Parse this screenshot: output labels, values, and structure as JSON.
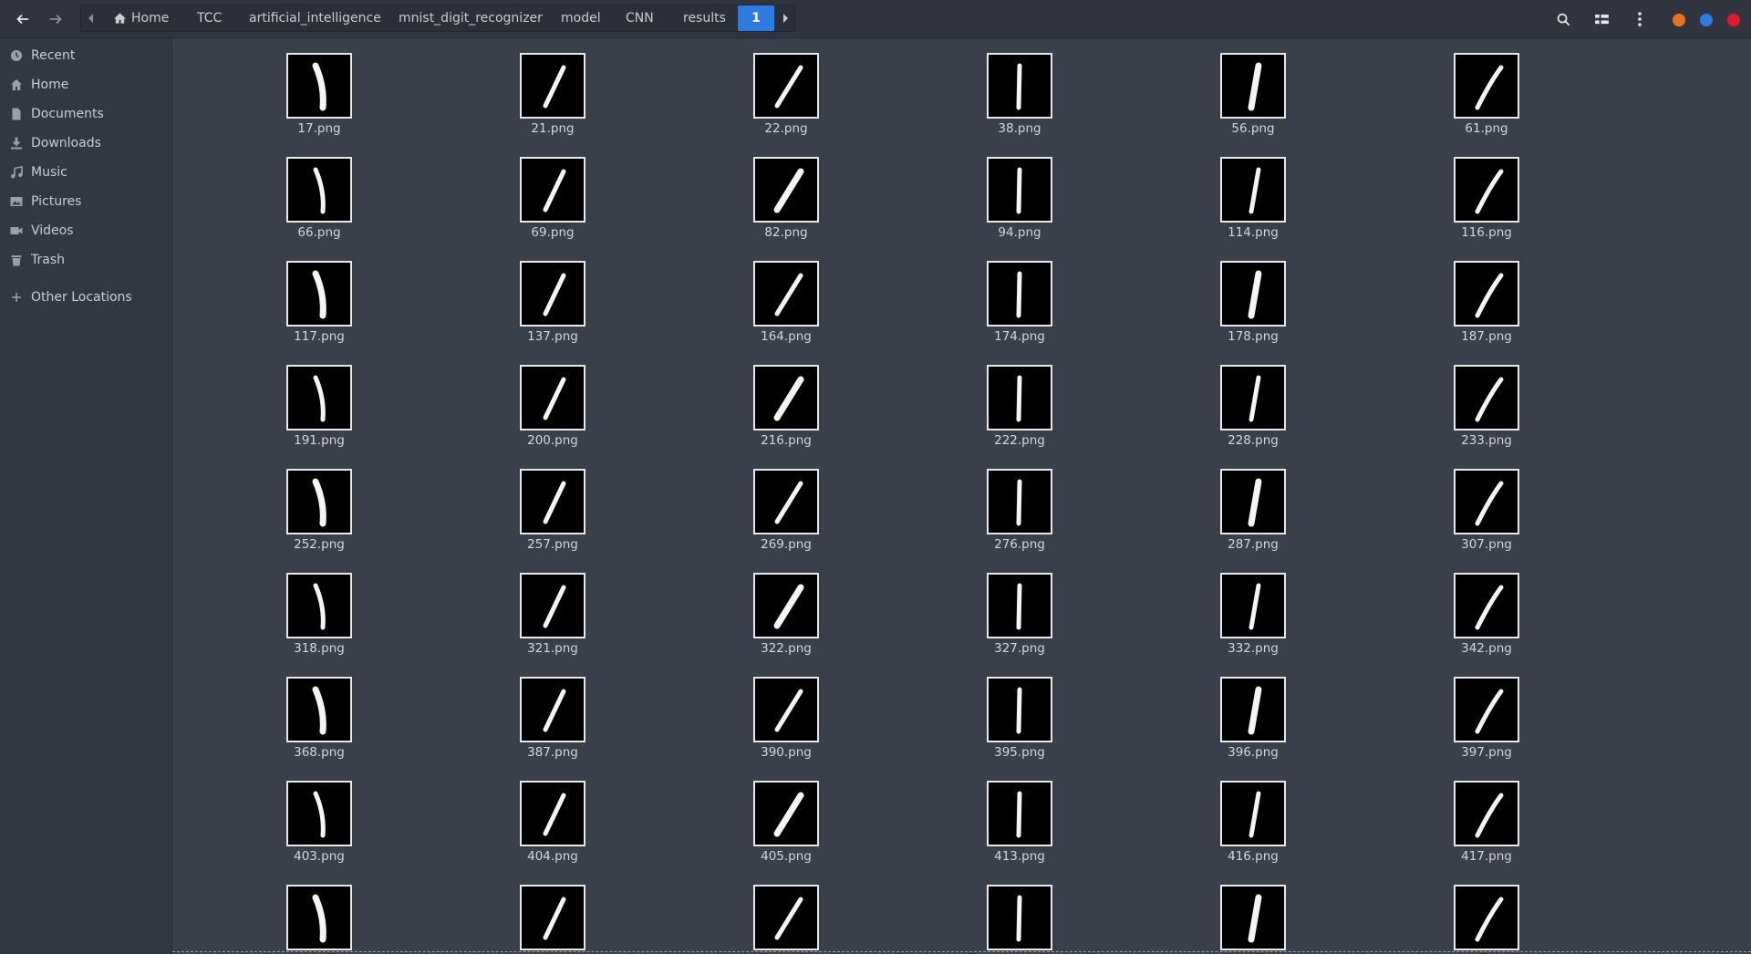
{
  "header": {
    "back_icon": "arrow-left-icon",
    "forward_icon": "arrow-right-icon",
    "breadcrumbs": [
      "Home",
      "TCC",
      "artificial_intelligence",
      "mnist_digit_recognizer",
      "model",
      "CNN",
      "results",
      "1"
    ],
    "active_crumb": "1",
    "search_icon": "search-icon",
    "view_icon": "view-options-icon",
    "menu_icon": "kebab-menu-icon",
    "window_controls": {
      "minimize_color": "#f0701a",
      "maximize_color": "#2d7ce3",
      "close_color": "#e2192c"
    }
  },
  "sidebar": {
    "items": [
      {
        "label": "Recent",
        "icon": "clock-icon"
      },
      {
        "label": "Home",
        "icon": "home-icon"
      },
      {
        "label": "Documents",
        "icon": "document-icon"
      },
      {
        "label": "Downloads",
        "icon": "download-icon"
      },
      {
        "label": "Music",
        "icon": "music-icon"
      },
      {
        "label": "Pictures",
        "icon": "picture-icon"
      },
      {
        "label": "Videos",
        "icon": "video-icon"
      },
      {
        "label": "Trash",
        "icon": "trash-icon"
      },
      {
        "label": "Other Locations",
        "icon": "plus-icon"
      }
    ]
  },
  "files": [
    "17.png",
    "21.png",
    "22.png",
    "38.png",
    "56.png",
    "61.png",
    "66.png",
    "69.png",
    "82.png",
    "94.png",
    "114.png",
    "116.png",
    "117.png",
    "137.png",
    "164.png",
    "174.png",
    "178.png",
    "187.png",
    "191.png",
    "200.png",
    "216.png",
    "222.png",
    "228.png",
    "233.png",
    "252.png",
    "257.png",
    "269.png",
    "276.png",
    "287.png",
    "307.png",
    "318.png",
    "321.png",
    "322.png",
    "327.png",
    "332.png",
    "342.png",
    "368.png",
    "387.png",
    "390.png",
    "395.png",
    "396.png",
    "397.png",
    "403.png",
    "404.png",
    "405.png",
    "413.png",
    "416.png",
    "417.png",
    "",
    "",
    "",
    "",
    "",
    ""
  ]
}
